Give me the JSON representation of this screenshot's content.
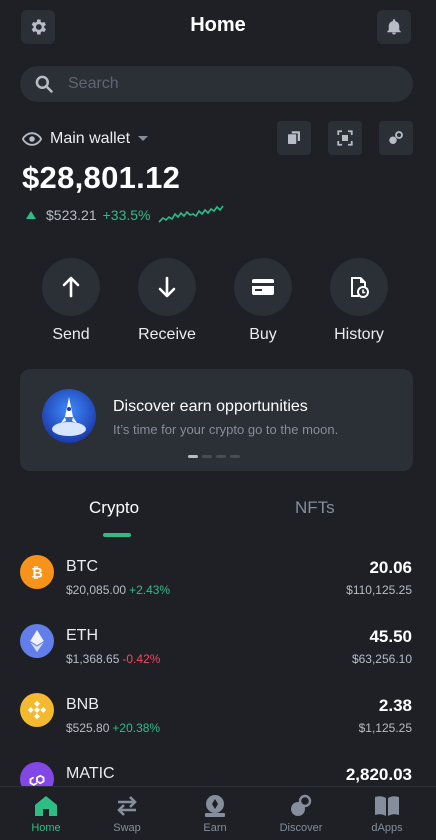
{
  "header": {
    "title": "Home"
  },
  "search": {
    "placeholder": "Search"
  },
  "wallet": {
    "name": "Main wallet",
    "balance": "$28,801.12",
    "change_amount": "$523.21",
    "change_percent": "+33.5%"
  },
  "actions": [
    {
      "label": "Send",
      "icon": "arrow-up-icon"
    },
    {
      "label": "Receive",
      "icon": "arrow-down-icon"
    },
    {
      "label": "Buy",
      "icon": "card-icon"
    },
    {
      "label": "History",
      "icon": "history-icon"
    }
  ],
  "banner": {
    "title": "Discover earn opportunities",
    "subtitle": "It’s time for your crypto go to the moon."
  },
  "tabs": {
    "crypto": "Crypto",
    "nfts": "NFTs"
  },
  "assets": [
    {
      "symbol": "BTC",
      "price": "$20,085.00",
      "change": "+2.43%",
      "amount": "20.06",
      "value": "$110,125.25",
      "color": "#f7931a"
    },
    {
      "symbol": "ETH",
      "price": "$1,368.65",
      "change": "-0.42%",
      "amount": "45.50",
      "value": "$63,256.10",
      "color": "#627eea"
    },
    {
      "symbol": "BNB",
      "price": "$525.80",
      "change": "+20.38%",
      "amount": "2.38",
      "value": "$1,125.25",
      "color": "#f3ba2f"
    },
    {
      "symbol": "MATIC",
      "amount": "2,820.03",
      "color": "#8247e5"
    }
  ],
  "nav": [
    {
      "label": "Home",
      "icon": "home-icon",
      "active": true
    },
    {
      "label": "Swap",
      "icon": "swap-icon"
    },
    {
      "label": "Earn",
      "icon": "earn-icon"
    },
    {
      "label": "Discover",
      "icon": "discover-icon"
    },
    {
      "label": "dApps",
      "icon": "book-icon"
    }
  ],
  "colors": {
    "background": "#1e2026",
    "surface": "#2b2f36",
    "accent_green": "#2ebd85",
    "accent_red": "#f6465d"
  }
}
